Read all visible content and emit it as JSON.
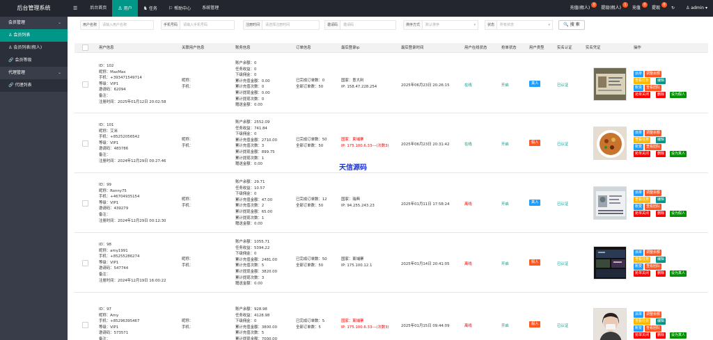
{
  "app": {
    "title": "后台管理系统"
  },
  "topnav": [
    {
      "icon": "☰",
      "label": ""
    },
    {
      "icon": "",
      "label": "后台首页"
    },
    {
      "icon": "♙",
      "label": "用户"
    },
    {
      "icon": "♞",
      "label": "任务"
    },
    {
      "icon": "⚐",
      "label": "帮助中心"
    },
    {
      "icon": "",
      "label": "系统管理"
    }
  ],
  "topright": [
    {
      "label": "充值(假人)",
      "count": "0"
    },
    {
      "label": "提现(假人)",
      "count": "1"
    },
    {
      "label": "充值",
      "count": "0"
    },
    {
      "label": "提现",
      "count": "0"
    }
  ],
  "admin": {
    "refresh_icon": "↻",
    "user": "admin ▾"
  },
  "sidebar": {
    "groups": [
      {
        "label": "会员管理",
        "items": [
          {
            "icon": "♙",
            "label": "会员列表",
            "active": true
          },
          {
            "icon": "♙",
            "label": "会员列表(假人)"
          },
          {
            "icon": "🔗",
            "label": "会员等级"
          }
        ]
      },
      {
        "label": "代理管理",
        "items": [
          {
            "icon": "🔗",
            "label": "代理列表"
          }
        ]
      }
    ]
  },
  "filters": {
    "username": {
      "label": "用户名称",
      "placeholder": "请输入用户名称"
    },
    "phone": {
      "label": "手机号码",
      "placeholder": "请输入手机号码"
    },
    "regtime": {
      "label": "注册时间",
      "placeholder": "请选择注册时间"
    },
    "invite": {
      "label": "邀请码",
      "placeholder": "邀请码"
    },
    "sort": {
      "label": "排序方式",
      "placeholder": "默认排序"
    },
    "status": {
      "label": "状态",
      "placeholder": "所有状态"
    },
    "search_button": "🔍 搜 索"
  },
  "table": {
    "headers": [
      "用户信息",
      "关联用户信息",
      "账务信息",
      "订单信息",
      "最后登录ip",
      "最后登录时间",
      "用户在线状态",
      "抢单状态",
      "用户类型",
      "实名认证",
      "实名凭证",
      "操作"
    ],
    "rows": [
      {
        "info": [
          "ID：102",
          "昵称：MaxMax",
          "手机：+393471549714",
          "等级：VIP1",
          "邀请码：62094",
          "备注：",
          "注册时间：2025年01月12日 20:02:58"
        ],
        "rel": [
          "昵称：",
          "手机："
        ],
        "acct": [
          "账户余额：0",
          "任务收益：0",
          "下级佣金：0",
          "累计充值金额：0.00",
          "累计充值次数：0",
          "累计提现金额：0.00",
          "累计提现次数：0",
          "赠送金额：0.00"
        ],
        "order": [
          "已完成订单数：0",
          "全部订单数：50"
        ],
        "ip": [
          "国家：意大利",
          "IP: 158.47.228.254"
        ],
        "ip_red": false,
        "time": "2025年06月23日 20:26:15",
        "online": "在线",
        "online_on": true,
        "grab": "开启",
        "type": "真人",
        "type_color": "blue",
        "auth": "已认证",
        "thumb": "idcard",
        "ops": [
          "派单",
          "调整余额",
          "查看任务",
          "编辑",
          "账变",
          "查看团队",
          "抢单关闭",
          "删除",
          "设为假人"
        ]
      },
      {
        "info": [
          "ID：101",
          "昵称：艾米",
          "手机：+85252056542",
          "等级：VIP1",
          "邀请码：483786",
          "备注：",
          "注册时间：2024年12月29日 00:27:46"
        ],
        "rel": [
          "昵称：",
          "手机："
        ],
        "acct": [
          "账户余额：2552.09",
          "任务收益：741.84",
          "下级佣金：0",
          "累计充值金额：2710.00",
          "累计充值次数：3",
          "累计提现金额：899.75",
          "累计提现次数：1",
          "赠送金额：0.00"
        ],
        "order": [
          "已完成订单数：50",
          "全部订单数：50"
        ],
        "ip": [
          "国家：柬埔寨",
          "IP: 175.100.6.33---(次数3)"
        ],
        "ip_red": true,
        "time": "2025年06月23日 20:31:42",
        "online": "在线",
        "online_on": true,
        "grab": "开启",
        "type": "假人",
        "type_color": "orange",
        "auth": "已认证",
        "thumb": "food",
        "ops": [
          "派单",
          "调整余额",
          "查看任务",
          "编辑",
          "账变",
          "查看团队",
          "抢单关闭",
          "删除",
          "设为真人"
        ]
      },
      {
        "info": [
          "ID：99",
          "昵称：Ronny75",
          "手机：+46704935154",
          "等级：VIP1",
          "邀请码：439279",
          "备注：",
          "注册时间：2024年12月29日 00:12:30"
        ],
        "rel": [
          "昵称：",
          "手机："
        ],
        "acct": [
          "账户余额：29.71",
          "任务收益：10.57",
          "下级佣金：0",
          "累计充值金额：47.00",
          "累计充值次数：2",
          "累计提现金额：65.00",
          "累计提现次数：1",
          "赠送金额：0.00"
        ],
        "order": [
          "已完成订单数：12",
          "全部订单数：50"
        ],
        "ip": [
          "国家：瑞典",
          "IP: 94.255.243.23"
        ],
        "ip_red": false,
        "time": "2025年01月11日 17:58:24",
        "online": "离线",
        "online_on": false,
        "grab": "开启",
        "type": "真人",
        "type_color": "blue",
        "auth": "已认证",
        "thumb": "passport",
        "ops": [
          "派单",
          "调整余额",
          "查看任务",
          "编辑",
          "账变",
          "查看团队",
          "抢单关闭",
          "删除",
          "设为假人"
        ]
      },
      {
        "info": [
          "ID：98",
          "昵称：amy1991",
          "手机：+85255286274",
          "等级：VIP1",
          "邀请码：547744",
          "备注：",
          "注册时间：2024年12月19日 16:00:22"
        ],
        "rel": [
          "昵称：",
          "手机："
        ],
        "acct": [
          "账户余额：1055.71",
          "任务收益：5394.22",
          "下级佣金：0",
          "累计充值金额：2481.00",
          "累计充值次数：5",
          "累计提现金额：3820.00",
          "累计提现次数：3",
          "赠送金额：0.00"
        ],
        "order": [
          "已完成订单数：50",
          "全部订单数：50"
        ],
        "ip": [
          "国家：柬埔寨",
          "IP: 175.100.12.1"
        ],
        "ip_red": false,
        "time": "2025年01月14日 20:41:05",
        "online": "离线",
        "online_on": false,
        "grab": "开启",
        "type": "假人",
        "type_color": "orange",
        "auth": "已认证",
        "thumb": "screen",
        "ops": [
          "派单",
          "调整余额",
          "查看任务",
          "编辑",
          "账变",
          "查看团队",
          "抢单关闭",
          "删除",
          "设为真人"
        ]
      },
      {
        "info": [
          "ID：97",
          "昵称：Amy",
          "手机：+85296395467",
          "等级：VIP1",
          "邀请码：573571",
          "备注："
        ],
        "rel": [
          "昵称：",
          "手机："
        ],
        "acct": [
          "账户余额：928.98",
          "任务收益：4128.98",
          "下级佣金：0",
          "累计充值金额：3800.00",
          "累计充值次数：5",
          "累计提现金额：7000.00"
        ],
        "order": [
          "已完成订单数：5",
          "全部订单数：5"
        ],
        "ip": [
          "国家：柬埔寨",
          "IP: 175.100.6.33---(次数3)"
        ],
        "ip_red": true,
        "time": "2025年01月15日 09:44:09",
        "online": "离线",
        "online_on": false,
        "grab": "开启",
        "type": "假人",
        "type_color": "orange",
        "auth": "已认证",
        "thumb": "selfie",
        "ops": [
          "派单",
          "调整余额",
          "查看任务",
          "编辑",
          "账变",
          "查看团队",
          "抢单关闭",
          "删除",
          "设为真人"
        ]
      }
    ]
  },
  "watermark": "天信源码"
}
